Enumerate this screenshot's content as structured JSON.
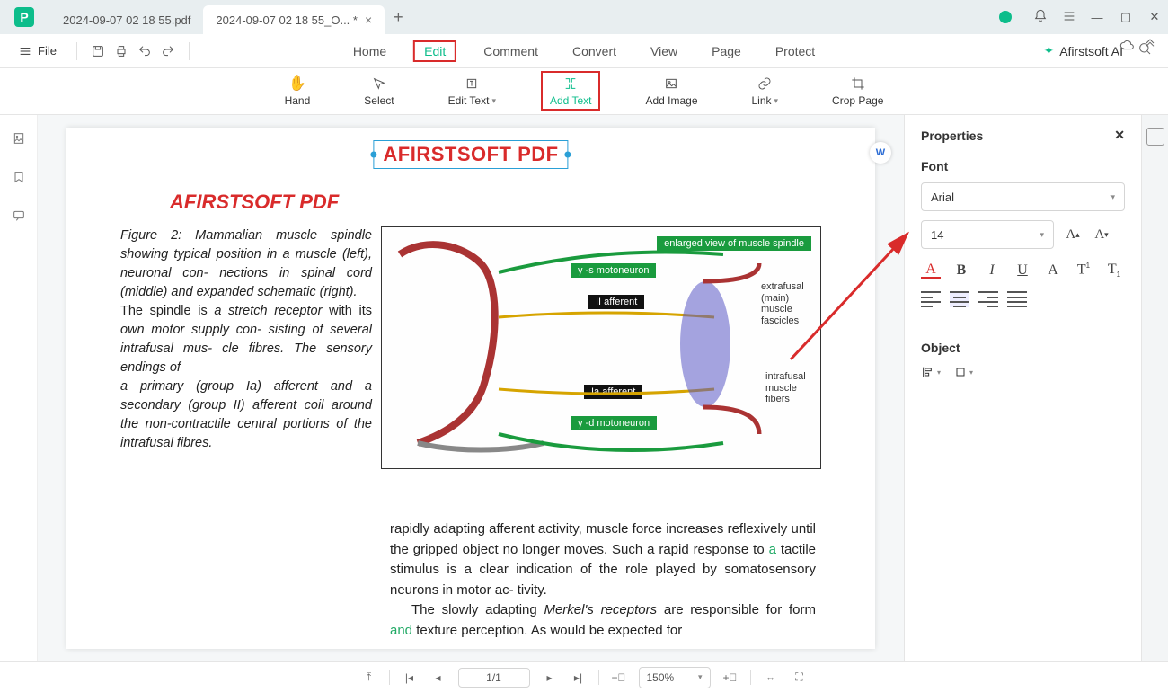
{
  "titlebar": {
    "tabs": [
      {
        "label": "2024-09-07 02 18 55.pdf"
      },
      {
        "label": "2024-09-07 02 18 55_O... *"
      }
    ]
  },
  "topbar": {
    "file_label": "File",
    "menu": {
      "home": "Home",
      "edit": "Edit",
      "comment": "Comment",
      "convert": "Convert",
      "view": "View",
      "page": "Page",
      "protect": "Protect"
    },
    "ai_label": "Afirstsoft AI"
  },
  "ribbon": {
    "hand": "Hand",
    "select": "Select",
    "edit_text": "Edit Text",
    "add_text": "Add Text",
    "add_image": "Add Image",
    "link": "Link",
    "crop_page": "Crop Page"
  },
  "page": {
    "added_text": "AFIRSTSOFT PDF",
    "heading": "AFIRSTSOFT PDF",
    "caption_html": "Figure 2: Mammalian muscle spindle showing typical position in a muscle (left), neuronal con- nections in spinal cord (middle) and expanded schematic (right).<br><span class='reg'>The spindle is</span> a stretch receptor <span class='reg'>with its</span> own motor supply con- sisting of several intrafusal mus- cle fibres. The sensory endings of<br>a primary (group Ia) afferent and a secondary (group II) afferent coil around the non-contractile central portions of the intrafusal fibres.",
    "fig_labels": {
      "top": "enlarged view of muscle spindle",
      "gs": "γ -s motoneuron",
      "ii": "II afferent",
      "ia": "Ia afferent",
      "gd": "γ -d motoneuron",
      "extra": "extrafusal (main) muscle fascicles",
      "intra": "intrafusal muscle fibers"
    },
    "body_html": "rapidly adapting afferent activity, muscle force increases reflexively until the gripped object no longer moves. Such a rapid response to <span class='lnk'>a</span> tactile stimulus is a clear indication of the role played by somatosensory neurons in motor ac- tivity.<br><span class='indent'></span>The slowly adapting <em>Merkel's receptors</em> are responsible for form <span class='lnk'>and</span> texture perception. As would be expected for"
  },
  "props": {
    "title": "Properties",
    "font_label": "Font",
    "font_name": "Arial",
    "font_size": "14",
    "object_label": "Object"
  },
  "status": {
    "page_indicator": "1/1",
    "zoom": "150%"
  }
}
